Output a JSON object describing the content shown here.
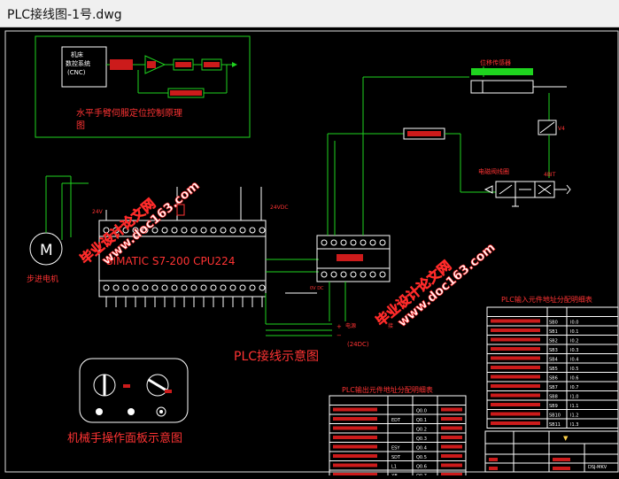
{
  "window": {
    "title": "PLC接线图-1号.dwg"
  },
  "drawing": {
    "servo_diagram_title_line1": "水平手臂伺服定位控制原理",
    "servo_diagram_title_line2": "图",
    "servo_block_label": "机床\n数控系统\n(CNC)",
    "servo_block_l1": "机床",
    "servo_block_l2": "数控系统",
    "servo_block_l3": "(CNC)",
    "plc_model": "SIMATIC  S7-200  CPU224",
    "motor_symbol": "M",
    "motor_label": "步进电机",
    "wiring_caption": "PLC接线示意图",
    "panel_caption": "机械手操作面板示意图",
    "input_table_title": "PLC输入元件地址分配明细表",
    "output_table_title": "PLC输出元件地址分配明细表",
    "sensor_label": "位移传感器",
    "valve_label": "电磁阀线圈",
    "voltage_24v": "24V",
    "voltage_24vdc": "24VDC",
    "voltage_24vdc_paren": "(24DC)",
    "label_0v": "0V",
    "label_ov_dc": "0V DC",
    "label_v4": "V4",
    "label_4bit": "4BIT",
    "legend_plus": "+",
    "legend_minus": "−",
    "legend_text1": "电源",
    "legend_text2": "接",
    "watermark_lines": [
      "毕业设计论文网",
      "www.doc163.com"
    ],
    "input_table_rows": [
      [
        "SB0",
        "I0.0"
      ],
      [
        "SB1",
        "I0.1"
      ],
      [
        "SB2",
        "I0.2"
      ],
      [
        "SB3",
        "I0.3"
      ],
      [
        "SB4",
        "I0.4"
      ],
      [
        "SB5",
        "I0.5"
      ],
      [
        "SB6",
        "I0.6"
      ],
      [
        "SB7",
        "I0.7"
      ],
      [
        "SB8",
        "I1.0"
      ],
      [
        "SB9",
        "I1.1"
      ],
      [
        "SB10",
        "I1.2"
      ],
      [
        "SB11",
        "I1.3"
      ]
    ],
    "output_table_rows": [
      [
        "",
        "Q0.0"
      ],
      [
        "EDT",
        "Q0.1"
      ],
      [
        "",
        "Q0.2"
      ],
      [
        "",
        "Q0.3"
      ],
      [
        "ESY",
        "Q0.4"
      ],
      [
        "SDT",
        "Q0.5"
      ],
      [
        "L1",
        "Q0.6"
      ],
      [
        "XB",
        "Q0.7"
      ]
    ],
    "title_block_mark": "▼",
    "title_block_code": "DSJ-MKV"
  }
}
